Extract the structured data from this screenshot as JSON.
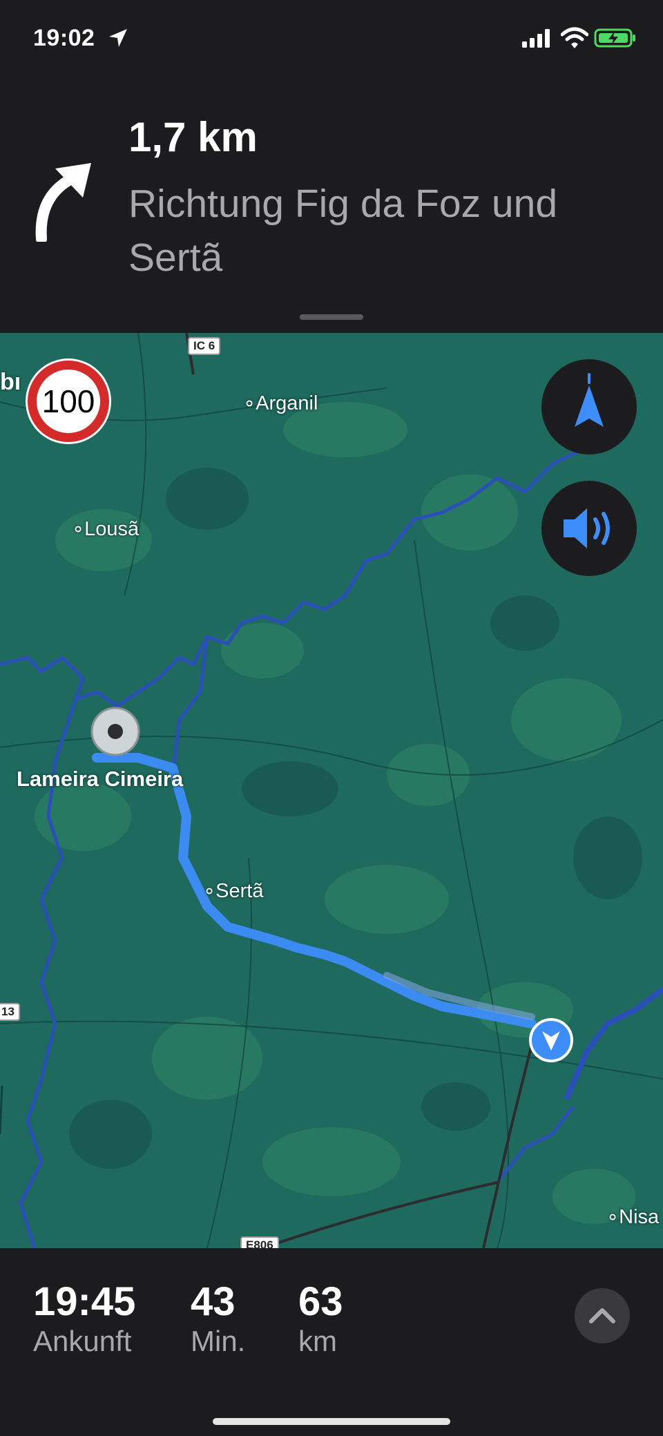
{
  "status_bar": {
    "time": "19:02"
  },
  "banner": {
    "distance": "1,7 km",
    "direction": "Richtung Fig da Foz und Sertã",
    "turn_icon": "turn-slight-right-arrow"
  },
  "map": {
    "speed_limit": "100",
    "cutoff_label": "bı",
    "places": {
      "arganil": "Arganil",
      "lousa": "Lousã",
      "lameira": "Lameira Cimeira",
      "serta": "Sertã",
      "nisa": "Nisa"
    },
    "shields": {
      "ic6": "IC 6",
      "r13": "13",
      "e806": "E806"
    },
    "buttons": {
      "compass_icon": "compass-arrow-icon",
      "audio_icon": "speaker-icon"
    }
  },
  "trip": {
    "arrival_value": "19:45",
    "arrival_label": "Ankunft",
    "duration_value": "43",
    "duration_label": "Min.",
    "distance_value": "63",
    "distance_label": "km"
  },
  "colors": {
    "route": "#3d8dfa",
    "map_green": "#1f6a5e",
    "water": "#2b4fb8",
    "speed_red": "#d42a2a"
  }
}
